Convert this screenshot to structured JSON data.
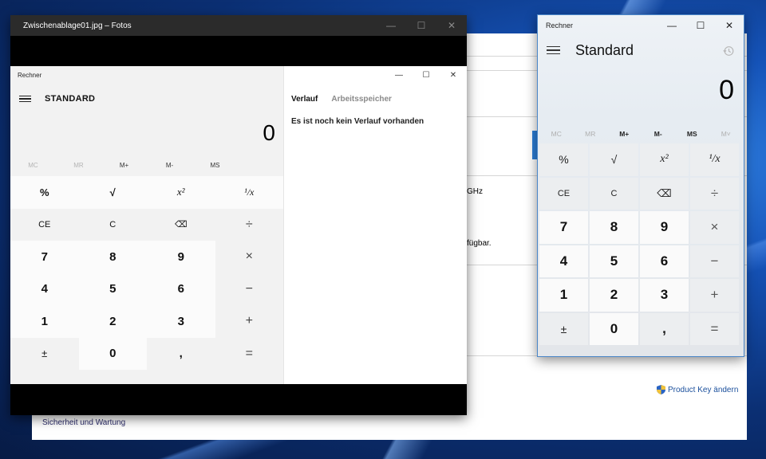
{
  "system_window": {
    "text_ghz": "GHz",
    "text_verfuegbar": "fügbar.",
    "link_product_key": "Product Key ändern",
    "link_security": "Sicherheit und Wartung"
  },
  "fotos": {
    "title": "Zwischenablage01.jpg – Fotos",
    "controls": {
      "minimize": "—",
      "maximize": "☐",
      "close": "✕"
    }
  },
  "inner_calc": {
    "title": "Rechner",
    "mode": "STANDARD",
    "display": "0",
    "memory": [
      "MC",
      "MR",
      "M+",
      "M-",
      "MS"
    ],
    "keys": [
      [
        "%",
        "√",
        "x²",
        "¹/x"
      ],
      [
        "CE",
        "C",
        "⌫",
        "÷"
      ],
      [
        "7",
        "8",
        "9",
        "×"
      ],
      [
        "4",
        "5",
        "6",
        "−"
      ],
      [
        "1",
        "2",
        "3",
        "+"
      ],
      [
        "±",
        "0",
        ",",
        "="
      ]
    ],
    "tabs": {
      "history": "Verlauf",
      "memory": "Arbeitsspeicher"
    },
    "history_empty": "Es ist noch kein Verlauf vorhanden",
    "controls": {
      "minimize": "—",
      "maximize": "☐",
      "close": "✕"
    }
  },
  "rechner": {
    "title": "Rechner",
    "mode": "Standard",
    "display": "0",
    "memory": [
      "MC",
      "MR",
      "M+",
      "M-",
      "MS",
      "M˅"
    ],
    "keys": [
      [
        "%",
        "√",
        "x²",
        "¹/x"
      ],
      [
        "CE",
        "C",
        "⌫",
        "÷"
      ],
      [
        "7",
        "8",
        "9",
        "×"
      ],
      [
        "4",
        "5",
        "6",
        "−"
      ],
      [
        "1",
        "2",
        "3",
        "+"
      ],
      [
        "±",
        "0",
        ",",
        "="
      ]
    ],
    "controls": {
      "minimize": "—",
      "maximize": "☐",
      "close": "✕"
    }
  }
}
